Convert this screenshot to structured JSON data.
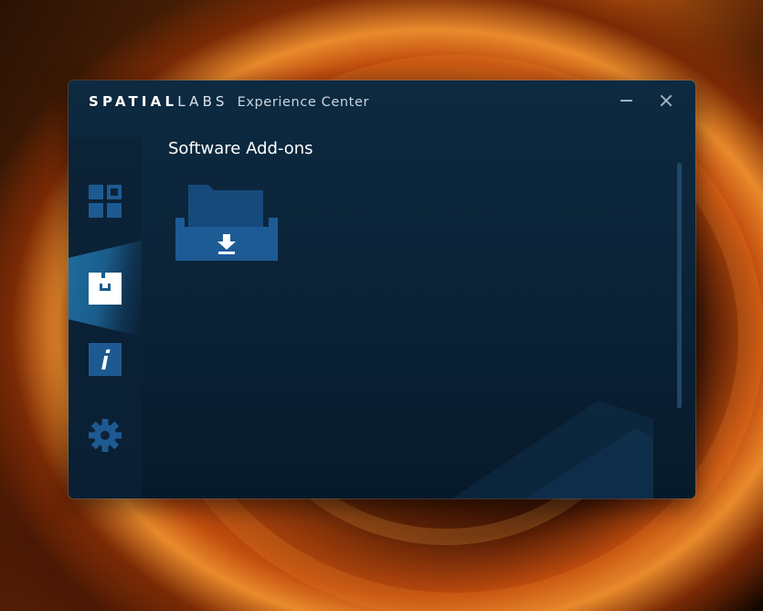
{
  "window": {
    "brand_bold": "SPATIAL",
    "brand_light": "LABS",
    "title": "Experience Center",
    "minimize_icon": "minimize-icon",
    "close_icon": "close-icon"
  },
  "sidebar": {
    "items": [
      {
        "id": "dashboard",
        "icon": "grid-icon",
        "active": false
      },
      {
        "id": "software-add-ons",
        "icon": "addons-box-icon",
        "active": true
      },
      {
        "id": "information",
        "icon": "info-icon",
        "active": false
      },
      {
        "id": "settings",
        "icon": "gear-icon",
        "active": false
      }
    ]
  },
  "main": {
    "page_title": "Software Add-ons",
    "tiles": [
      {
        "icon": "download-folder-icon"
      }
    ]
  },
  "colors": {
    "window_bg": "#0a2236",
    "accent": "#1d6d9f",
    "icon_blue": "#1e5a92",
    "text": "#ffffff"
  }
}
